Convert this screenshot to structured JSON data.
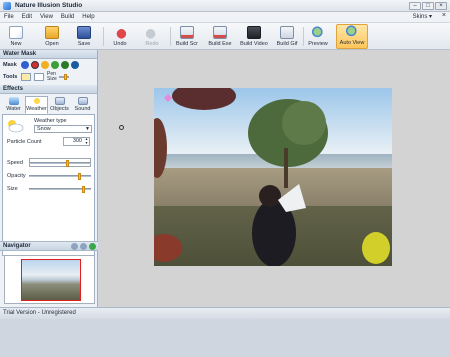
{
  "window": {
    "title": "Nature Illusion Studio",
    "minimize_glyph": "–",
    "maximize_glyph": "□",
    "close_glyph": "×"
  },
  "menu": {
    "items": [
      "File",
      "Edit",
      "View",
      "Build",
      "Help"
    ],
    "skins_label": "Skins ▾",
    "close_glyph": "×"
  },
  "toolbar": {
    "new": "New",
    "open": "Open",
    "save": "Save",
    "undo": "Undo",
    "redo": "Redo",
    "build_scr": "Build Scr",
    "build_exe": "Build Exe",
    "build_video": "Build Video",
    "build_gif": "Build Gif",
    "preview": "Preview",
    "auto_view": "Auto View"
  },
  "water_mask": {
    "heading": "Water Mask",
    "mask_label": "Mask",
    "tools_label": "Tools",
    "pen_size_label_1": "Pen",
    "pen_size_label_2": "Size",
    "mask_colors": [
      "#2f5fd0",
      "#d0302f",
      "#f0b020",
      "#3aa03a",
      "#2a7a2a",
      "#1a5aa0"
    ]
  },
  "effects": {
    "heading": "Effects",
    "tabs": [
      "Water",
      "Weather",
      "Objects",
      "Sound"
    ],
    "active_tab": "Weather",
    "weather_type_label": "Weather type",
    "weather_type_value": "Snow",
    "particle_count_label": "Particle Count",
    "particle_count_value": "300",
    "speed_label": "Speed",
    "opacity_label": "Opacity",
    "size_label": "Size",
    "speed_level": 0.62,
    "opacity_level": 0.83,
    "size_level": 0.9
  },
  "navigator": {
    "heading": "Navigator"
  },
  "status": {
    "text": "Trial Version - Unregistered"
  }
}
